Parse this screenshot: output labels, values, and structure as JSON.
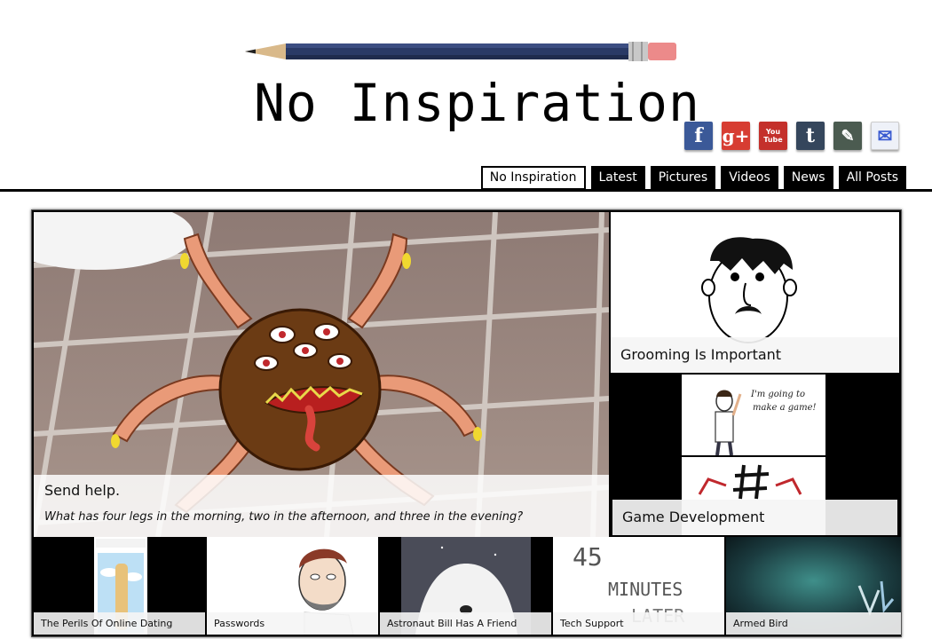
{
  "site": {
    "title": "No Inspiration"
  },
  "social": [
    {
      "name": "facebook",
      "glyph": "f",
      "color": "#3b5998"
    },
    {
      "name": "google-plus",
      "glyph": "g+",
      "color": "#d73d32"
    },
    {
      "name": "youtube",
      "glyph": "You Tube",
      "color": "#c4302b"
    },
    {
      "name": "tumblr",
      "glyph": "t",
      "color": "#35465c"
    },
    {
      "name": "deviantart",
      "glyph": "✎",
      "color": "#4b5b50"
    },
    {
      "name": "email",
      "glyph": "✉",
      "color": "#e8ecf5"
    }
  ],
  "nav": {
    "tabs": [
      "No Inspiration",
      "Latest",
      "Pictures",
      "Videos",
      "News",
      "All Posts"
    ],
    "active": "No Inspiration"
  },
  "featured": {
    "title": "Send help.",
    "subtitle": "What has four legs in the morning, two in the afternoon, and three in the evening?"
  },
  "side_posts": [
    {
      "title": "Grooming Is Important"
    },
    {
      "title": "Game Development",
      "handwriting": "I'm going to make a game!"
    }
  ],
  "thumbnails": [
    {
      "title": "The Perils Of Online Dating"
    },
    {
      "title": "Passwords"
    },
    {
      "title": "Astronaut Bill Has A Friend"
    },
    {
      "title": "Tech Support",
      "art_text": [
        "45",
        "MINUTES",
        "LATER"
      ]
    },
    {
      "title": "Armed Bird"
    }
  ]
}
